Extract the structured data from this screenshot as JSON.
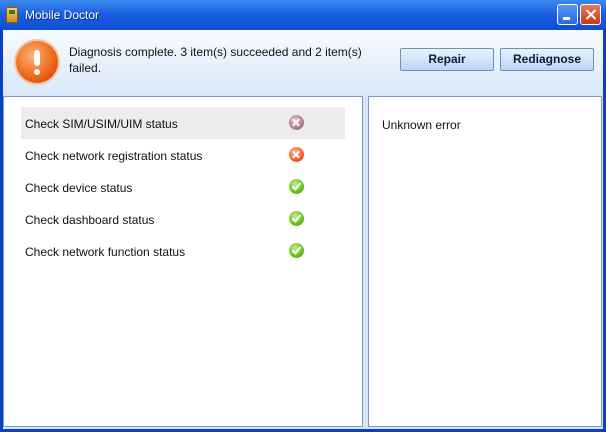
{
  "window": {
    "title": "Mobile Doctor",
    "icon": "mobile-doctor-icon"
  },
  "header": {
    "icon": "alert-icon",
    "message": "Diagnosis complete. 3 item(s) succeeded and 2 item(s) failed.",
    "repair_label": "Repair",
    "rediagnose_label": "Rediagnose"
  },
  "checks": [
    {
      "label": "Check SIM/USIM/UIM status",
      "status": "failed",
      "icon": "fail-icon",
      "selected": true
    },
    {
      "label": "Check network registration status",
      "status": "failed",
      "icon": "fail-icon",
      "selected": false
    },
    {
      "label": "Check device status",
      "status": "succeeded",
      "icon": "check-icon",
      "selected": false
    },
    {
      "label": "Check dashboard status",
      "status": "succeeded",
      "icon": "check-icon",
      "selected": false
    },
    {
      "label": "Check network function status",
      "status": "succeeded",
      "icon": "check-icon",
      "selected": false
    }
  ],
  "detail": {
    "text": "Unknown error"
  },
  "colors": {
    "titlebar": "#1b5fe0",
    "frame": "#0a3fc8",
    "fail": "#ef5a26",
    "success": "#5cbb1e",
    "selection": "#ececec"
  }
}
